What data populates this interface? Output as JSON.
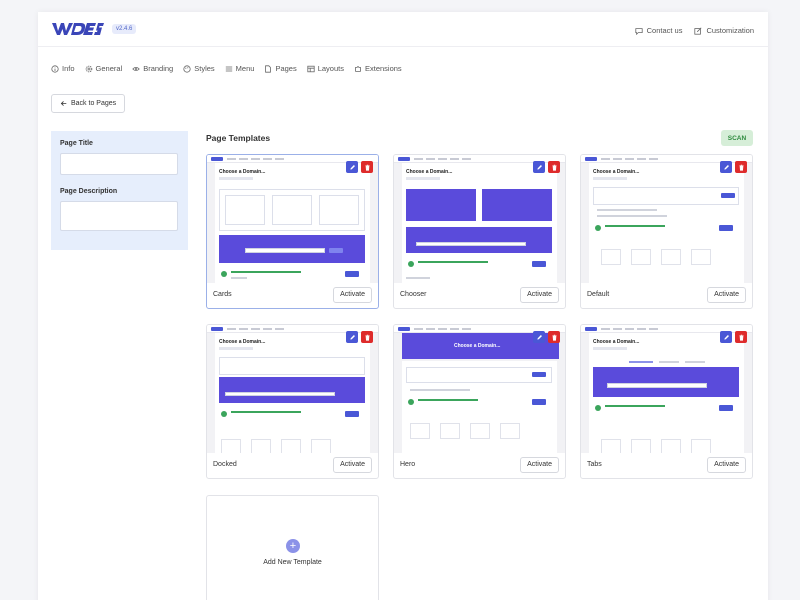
{
  "header": {
    "logo_text": "WDES",
    "version": "v2.4.6",
    "contact_label": "Contact us",
    "customization_label": "Customization"
  },
  "nav": {
    "items": [
      {
        "label": "Info",
        "icon": "info-icon"
      },
      {
        "label": "General",
        "icon": "gear-icon"
      },
      {
        "label": "Branding",
        "icon": "eye-icon"
      },
      {
        "label": "Styles",
        "icon": "palette-icon"
      },
      {
        "label": "Menu",
        "icon": "menu-icon"
      },
      {
        "label": "Pages",
        "icon": "page-icon"
      },
      {
        "label": "Layouts",
        "icon": "layout-icon"
      },
      {
        "label": "Extensions",
        "icon": "puzzle-icon"
      }
    ]
  },
  "back_label": "Back to Pages",
  "form": {
    "page_title_label": "Page Title",
    "page_title_value": "",
    "page_description_label": "Page Description",
    "page_description_value": ""
  },
  "templates": {
    "title": "Page Templates",
    "scan_label": "SCAN",
    "activate_label": "Activate",
    "items": [
      {
        "name": "Cards"
      },
      {
        "name": "Chooser"
      },
      {
        "name": "Default"
      },
      {
        "name": "Docked"
      },
      {
        "name": "Hero"
      },
      {
        "name": "Tabs"
      }
    ],
    "thumb_heading": "Choose a Domain...",
    "thumb_hero_heading": "Choose a Domain...",
    "add_label": "Add New Template",
    "add_symbol": "+"
  },
  "colors": {
    "accent": "#4a57d6",
    "banner": "#5a4bdb",
    "danger": "#de2b2b",
    "scan_bg": "#d6eed8",
    "form_bg": "#e6eefc"
  }
}
